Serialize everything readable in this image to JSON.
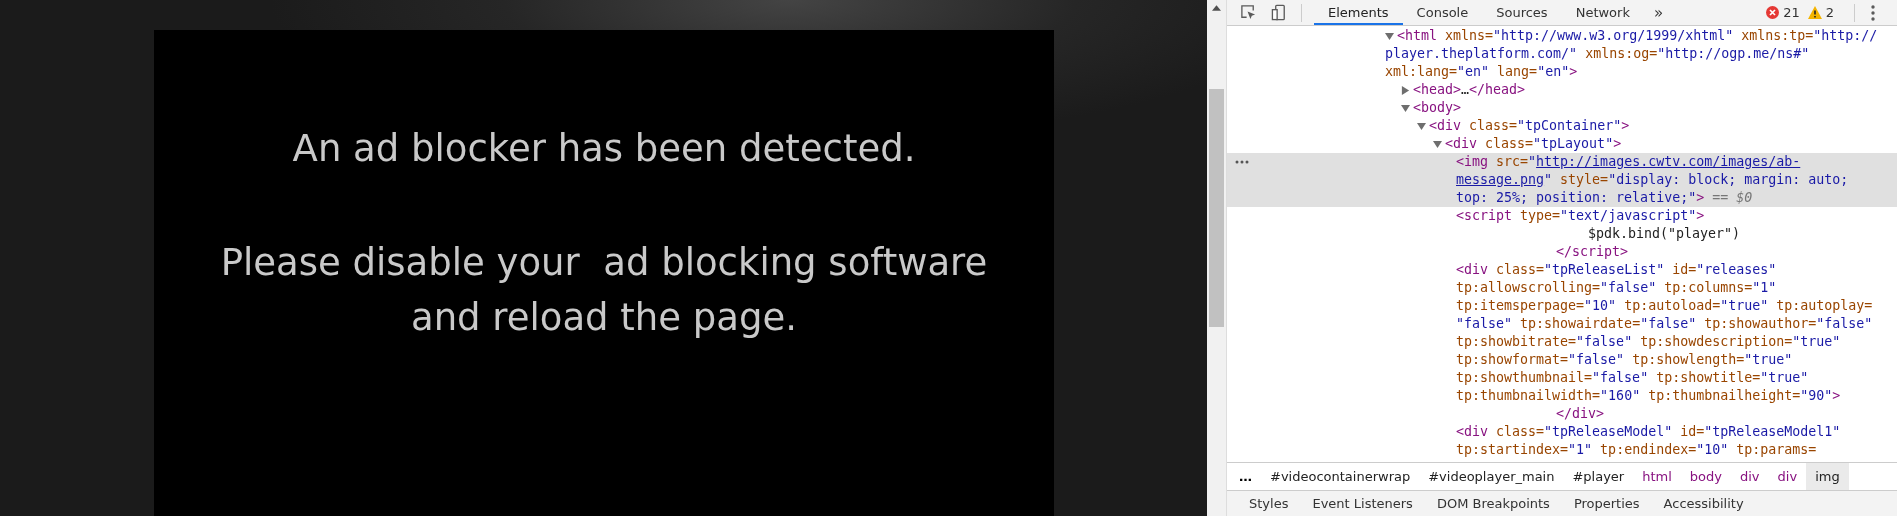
{
  "page": {
    "messages": [
      {
        "kind": "heading",
        "text": "An ad blocker has been detected."
      },
      {
        "kind": "body",
        "text": "Please disable your  ad blocking software\nand reload the page."
      }
    ]
  },
  "devtools": {
    "tabs": [
      {
        "label": "Elements",
        "selected": true
      },
      {
        "label": "Console",
        "selected": false
      },
      {
        "label": "Sources",
        "selected": false
      },
      {
        "label": "Network",
        "selected": false
      }
    ],
    "more_tabs": "»",
    "errors": "21",
    "warnings": "2",
    "dom_tree": [
      {
        "expanded": true,
        "selected": false,
        "lines": [
          {
            "tokens": [
              {
                "kind": "tag",
                "text": "<html"
              },
              {
                "kind": "attr",
                "text": " xmlns="
              },
              {
                "kind": "value",
                "text": "\"http://www.w3.org/1999/xhtml\""
              },
              {
                "kind": "attr",
                "text": " xmlns:tp="
              },
              {
                "kind": "value",
                "text": "\"http://"
              }
            ]
          },
          {
            "tokens": [
              {
                "kind": "value",
                "text": "player.theplatform.com/\""
              },
              {
                "kind": "attr",
                "text": " xmlns:og="
              },
              {
                "kind": "value",
                "text": "\"http://ogp.me/ns#\""
              }
            ]
          },
          {
            "tokens": [
              {
                "kind": "attr",
                "text": "xml:lang="
              },
              {
                "kind": "value",
                "text": "\"en\""
              },
              {
                "kind": "attr",
                "text": " lang="
              },
              {
                "kind": "value",
                "text": "\"en\""
              },
              {
                "kind": "tag",
                "text": ">"
              }
            ]
          }
        ],
        "children": [
          {
            "expanded": false,
            "selected": false,
            "lines": [
              {
                "tokens": [
                  {
                    "kind": "tag",
                    "text": "<head>"
                  },
                  {
                    "kind": "text",
                    "text": "…"
                  },
                  {
                    "kind": "tag",
                    "text": "</head>"
                  }
                ]
              }
            ]
          },
          {
            "expanded": true,
            "selected": false,
            "lines": [
              {
                "tokens": [
                  {
                    "kind": "tag",
                    "text": "<body>"
                  }
                ]
              }
            ],
            "children": [
              {
                "expanded": true,
                "selected": false,
                "lines": [
                  {
                    "tokens": [
                      {
                        "kind": "tag",
                        "text": "<div"
                      },
                      {
                        "kind": "attr",
                        "text": " class="
                      },
                      {
                        "kind": "value",
                        "text": "\"tpContainer\""
                      },
                      {
                        "kind": "tag",
                        "text": ">"
                      }
                    ]
                  }
                ],
                "children": [
                  {
                    "expanded": true,
                    "selected": false,
                    "lines": [
                      {
                        "tokens": [
                          {
                            "kind": "tag",
                            "text": "<div"
                          },
                          {
                            "kind": "attr",
                            "text": " class="
                          },
                          {
                            "kind": "value",
                            "text": "\"tpLayout\""
                          },
                          {
                            "kind": "tag",
                            "text": ">"
                          }
                        ]
                      }
                    ],
                    "children": [
                      {
                        "selected": true,
                        "lines": [
                          {
                            "tokens": [
                              {
                                "kind": "tag",
                                "text": "<img"
                              },
                              {
                                "kind": "attr",
                                "text": " src="
                              },
                              {
                                "kind": "value",
                                "text": "\""
                              },
                              {
                                "kind": "link",
                                "text": "http://images.cwtv.com/images/ab-"
                              }
                            ]
                          },
                          {
                            "tokens": [
                              {
                                "kind": "link",
                                "text": "message.png"
                              },
                              {
                                "kind": "value",
                                "text": "\""
                              },
                              {
                                "kind": "attr",
                                "text": " style="
                              },
                              {
                                "kind": "value",
                                "text": "\"display: block; margin: auto;"
                              }
                            ]
                          },
                          {
                            "tokens": [
                              {
                                "kind": "value",
                                "text": "top: 25%; position: relative;\""
                              },
                              {
                                "kind": "tag",
                                "text": ">"
                              },
                              {
                                "kind": "marker",
                                "text": " == $0"
                              }
                            ]
                          }
                        ]
                      },
                      {
                        "selected": false,
                        "lines": [
                          {
                            "tokens": [
                              {
                                "kind": "tag",
                                "text": "<script"
                              },
                              {
                                "kind": "attr",
                                "text": " type="
                              },
                              {
                                "kind": "value",
                                "text": "\"text/javascript\""
                              },
                              {
                                "kind": "tag",
                                "text": ">"
                              }
                            ]
                          },
                          {
                            "kind": "inner",
                            "tokens": [
                              {
                                "kind": "text",
                                "text": "$pdk.bind(\"player\")"
                              }
                            ]
                          },
                          {
                            "kind": "close",
                            "tokens": [
                              {
                                "kind": "tag",
                                "text": "</script>"
                              }
                            ]
                          }
                        ]
                      },
                      {
                        "selected": false,
                        "lines": [
                          {
                            "tokens": [
                              {
                                "kind": "tag",
                                "text": "<div"
                              },
                              {
                                "kind": "attr",
                                "text": " class="
                              },
                              {
                                "kind": "value",
                                "text": "\"tpReleaseList\""
                              },
                              {
                                "kind": "attr",
                                "text": " id="
                              },
                              {
                                "kind": "value",
                                "text": "\"releases\""
                              }
                            ]
                          },
                          {
                            "tokens": [
                              {
                                "kind": "attr",
                                "text": "tp:allowscrolling="
                              },
                              {
                                "kind": "value",
                                "text": "\"false\""
                              },
                              {
                                "kind": "attr",
                                "text": " tp:columns="
                              },
                              {
                                "kind": "value",
                                "text": "\"1\""
                              }
                            ]
                          },
                          {
                            "tokens": [
                              {
                                "kind": "attr",
                                "text": "tp:itemsperpage="
                              },
                              {
                                "kind": "value",
                                "text": "\"10\""
                              },
                              {
                                "kind": "attr",
                                "text": " tp:autoload="
                              },
                              {
                                "kind": "value",
                                "text": "\"true\""
                              },
                              {
                                "kind": "attr",
                                "text": " tp:autoplay="
                              }
                            ]
                          },
                          {
                            "tokens": [
                              {
                                "kind": "value",
                                "text": "\"false\""
                              },
                              {
                                "kind": "attr",
                                "text": " tp:showairdate="
                              },
                              {
                                "kind": "value",
                                "text": "\"false\""
                              },
                              {
                                "kind": "attr",
                                "text": " tp:showauthor="
                              },
                              {
                                "kind": "value",
                                "text": "\"false\""
                              }
                            ]
                          },
                          {
                            "tokens": [
                              {
                                "kind": "attr",
                                "text": "tp:showbitrate="
                              },
                              {
                                "kind": "value",
                                "text": "\"false\""
                              },
                              {
                                "kind": "attr",
                                "text": " tp:showdescription="
                              },
                              {
                                "kind": "value",
                                "text": "\"true\""
                              }
                            ]
                          },
                          {
                            "tokens": [
                              {
                                "kind": "attr",
                                "text": "tp:showformat="
                              },
                              {
                                "kind": "value",
                                "text": "\"false\""
                              },
                              {
                                "kind": "attr",
                                "text": " tp:showlength="
                              },
                              {
                                "kind": "value",
                                "text": "\"true\""
                              }
                            ]
                          },
                          {
                            "tokens": [
                              {
                                "kind": "attr",
                                "text": "tp:showthumbnail="
                              },
                              {
                                "kind": "value",
                                "text": "\"false\""
                              },
                              {
                                "kind": "attr",
                                "text": " tp:showtitle="
                              },
                              {
                                "kind": "value",
                                "text": "\"true\""
                              }
                            ]
                          },
                          {
                            "tokens": [
                              {
                                "kind": "attr",
                                "text": "tp:thumbnailwidth="
                              },
                              {
                                "kind": "value",
                                "text": "\"160\""
                              },
                              {
                                "kind": "attr",
                                "text": " tp:thumbnailheight="
                              },
                              {
                                "kind": "value",
                                "text": "\"90\""
                              },
                              {
                                "kind": "tag",
                                "text": ">"
                              }
                            ]
                          },
                          {
                            "kind": "close",
                            "tokens": [
                              {
                                "kind": "tag",
                                "text": "</div>"
                              }
                            ]
                          }
                        ]
                      },
                      {
                        "selected": false,
                        "lines": [
                          {
                            "tokens": [
                              {
                                "kind": "tag",
                                "text": "<div"
                              },
                              {
                                "kind": "attr",
                                "text": " class="
                              },
                              {
                                "kind": "value",
                                "text": "\"tpReleaseModel\""
                              },
                              {
                                "kind": "attr",
                                "text": " id="
                              },
                              {
                                "kind": "value",
                                "text": "\"tpReleaseModel1\""
                              }
                            ]
                          },
                          {
                            "tokens": [
                              {
                                "kind": "attr",
                                "text": "tp:startindex="
                              },
                              {
                                "kind": "value",
                                "text": "\"1\""
                              },
                              {
                                "kind": "attr",
                                "text": " tp:endindex="
                              },
                              {
                                "kind": "value",
                                "text": "\"10\""
                              },
                              {
                                "kind": "attr",
                                "text": " tp:params="
                              }
                            ]
                          }
                        ]
                      }
                    ]
                  }
                ]
              }
            ]
          }
        ]
      }
    ],
    "breadcrumbs": [
      {
        "kind": "more",
        "label": "…",
        "selected": false
      },
      {
        "kind": "id",
        "label": "#videocontainerwrap",
        "selected": false
      },
      {
        "kind": "id",
        "label": "#videoplayer_main",
        "selected": false
      },
      {
        "kind": "id",
        "label": "#player",
        "selected": false
      },
      {
        "kind": "tag",
        "label": "html",
        "selected": false
      },
      {
        "kind": "tag",
        "label": "body",
        "selected": false
      },
      {
        "kind": "tag",
        "label": "div",
        "selected": false
      },
      {
        "kind": "tag",
        "label": "div",
        "selected": false
      },
      {
        "kind": "tag",
        "label": "img",
        "selected": true
      }
    ],
    "panel_tabs": [
      "Styles",
      "Event Listeners",
      "DOM Breakpoints",
      "Properties",
      "Accessibility"
    ]
  }
}
